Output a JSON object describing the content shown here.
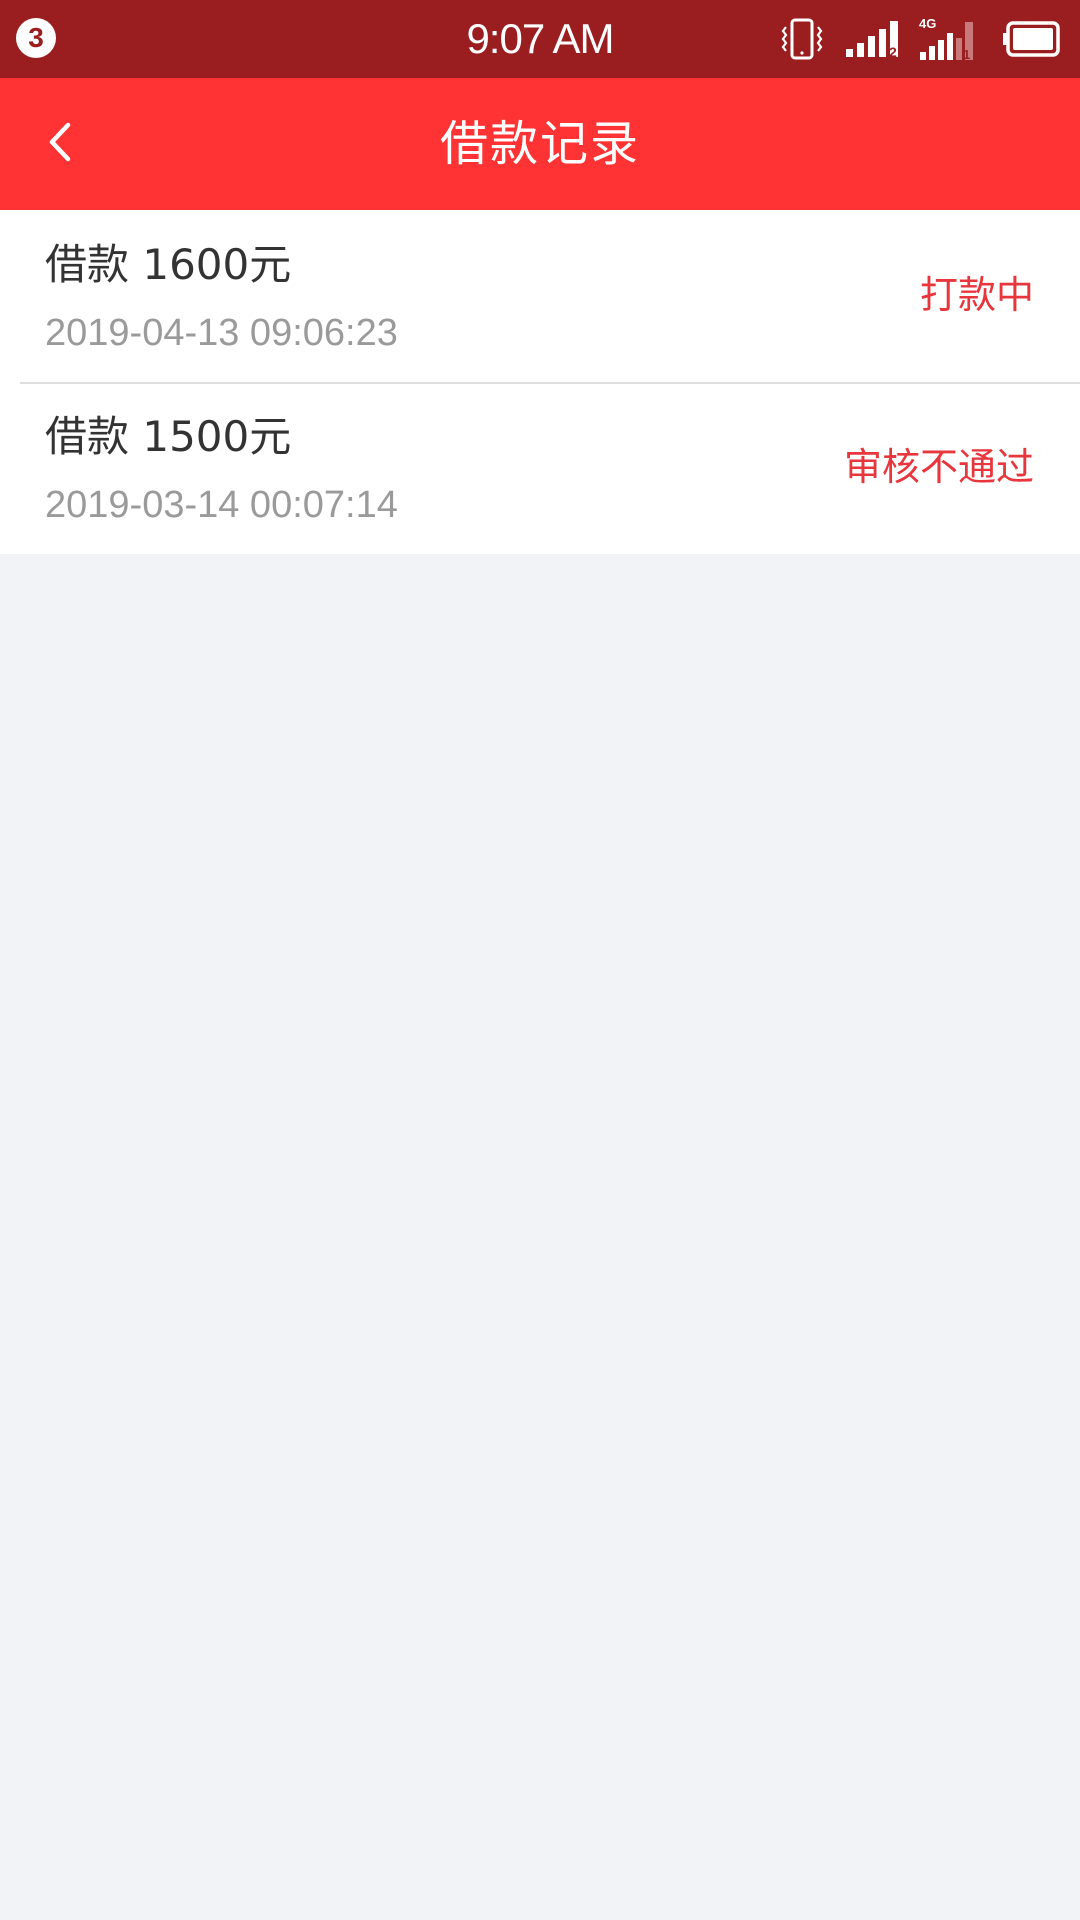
{
  "status_bar": {
    "notification_count": "3",
    "time": "9:07 AM",
    "sim2_label": "2",
    "network_label": "4G",
    "sim1_label": "1",
    "icons": [
      "vibrate-icon",
      "signal-sim2-icon",
      "signal-4g-icon",
      "battery-icon"
    ]
  },
  "header": {
    "title": "借款记录",
    "back_icon": "chevron-left-icon"
  },
  "records": [
    {
      "title": "借款 1600元",
      "time": "2019-04-13 09:06:23",
      "status": "打款中"
    },
    {
      "title": "借款 1500元",
      "time": "2019-03-14 00:07:14",
      "status": "审核不通过"
    }
  ],
  "colors": {
    "status_bar_bg": "#9a1d1f",
    "header_bg": "#ff3334",
    "status_text": "#e8363d",
    "page_bg": "#f2f3f7"
  }
}
